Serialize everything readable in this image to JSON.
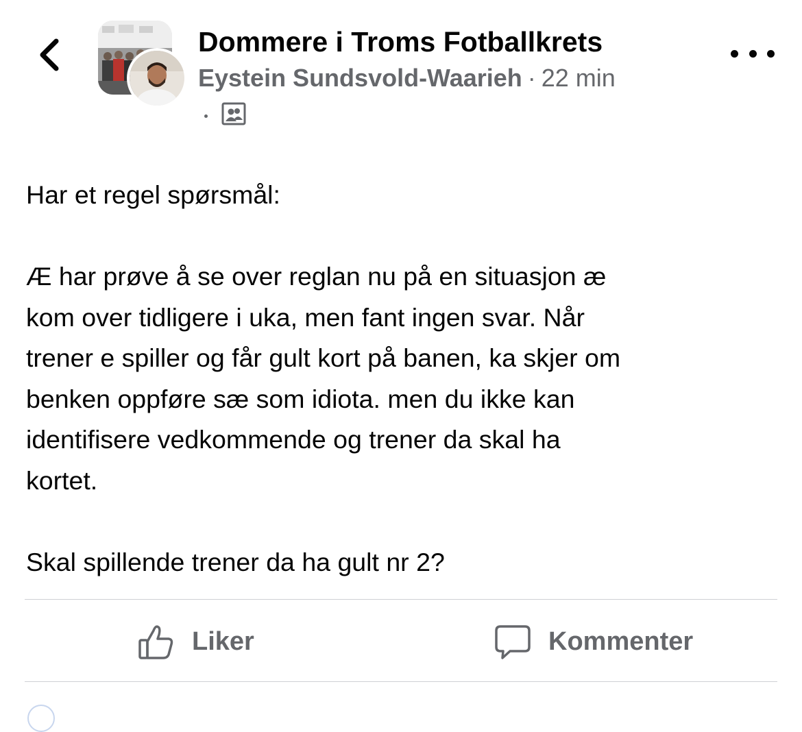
{
  "header": {
    "back_icon": "chevron-left-icon",
    "group_name": "Dommere i Troms Fotballkrets",
    "author": "Eystein Sundsvold-Waarieh",
    "separator": "·",
    "time": "22 min",
    "privacy_icon": "group-members-icon",
    "more_icon": "more-horizontal-icon"
  },
  "post": {
    "paragraphs": [
      "Har et regel spørsmål:",
      "Æ har prøve å se over reglan nu på en situasjon æ\nkom over tidligere i uka, men fant ingen svar. Når\ntrener e spiller og får gult kort på banen, ka skjer om\nbenken oppføre sæ som idiota. men du ikke kan\nidentifisere vedkommende og trener da skal ha\nkortet.",
      "Skal spillende trener da ha gult nr 2?"
    ]
  },
  "actions": {
    "like_label": "Liker",
    "like_icon": "thumbs-up-icon",
    "comment_label": "Kommenter",
    "comment_icon": "comment-bubble-icon"
  },
  "colors": {
    "primary_text": "#050505",
    "secondary_text": "#65676b",
    "divider": "#ced0d4",
    "background": "#ffffff"
  }
}
